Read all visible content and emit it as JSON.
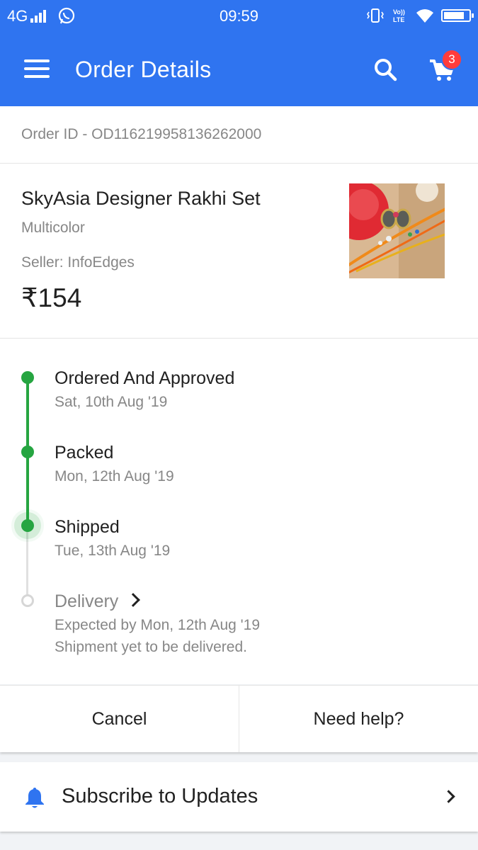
{
  "status_bar": {
    "network": "4G",
    "time": "09:59",
    "icons": [
      "signal-icon",
      "whatsapp-icon",
      "vibrate-icon",
      "volte-icon",
      "wifi-icon",
      "battery-icon"
    ]
  },
  "app_bar": {
    "title": "Order Details",
    "cart_count": "3",
    "icons": [
      "menu-icon",
      "search-icon",
      "cart-icon"
    ]
  },
  "order": {
    "id_text": "Order ID - OD116219958136262000"
  },
  "product": {
    "name": "SkyAsia Designer Rakhi Set",
    "color": "Multicolor",
    "seller": "Seller: InfoEdges",
    "price": "₹154"
  },
  "tracking": {
    "steps": [
      {
        "title": "Ordered And Approved",
        "date": "Sat, 10th Aug '19",
        "status": "done"
      },
      {
        "title": "Packed",
        "date": "Mon, 12th Aug '19",
        "status": "done"
      },
      {
        "title": "Shipped",
        "date": "Tue, 13th Aug '19",
        "status": "current"
      },
      {
        "title": "Delivery",
        "date": "Expected by Mon, 12th Aug '19",
        "note": "Shipment yet to be delivered.",
        "status": "pending"
      }
    ]
  },
  "actions": {
    "cancel": "Cancel",
    "help": "Need help?"
  },
  "subscribe": {
    "label": "Subscribe to Updates"
  },
  "colors": {
    "brand_blue": "#2f74f0",
    "progress_green": "#26a541",
    "badge_red": "#ff3c3c"
  }
}
